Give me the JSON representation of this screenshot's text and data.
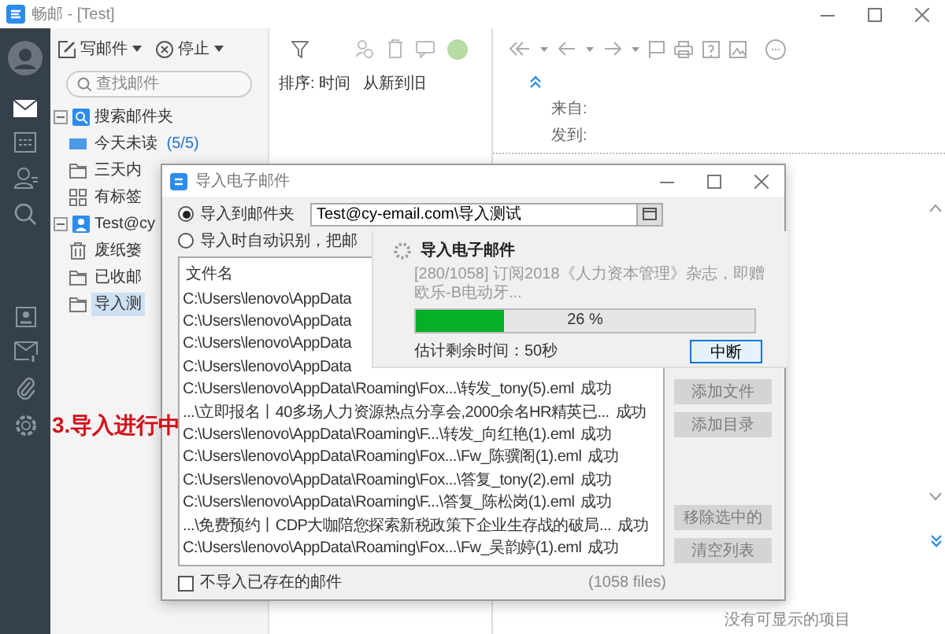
{
  "window": {
    "title": "畅邮 - [Test]"
  },
  "nav": [
    {
      "kind": "mail",
      "selected": true
    },
    {
      "kind": "calendar",
      "selected": false
    },
    {
      "kind": "contacts",
      "selected": false
    },
    {
      "kind": "search",
      "selected": false
    },
    {
      "kind": "card",
      "selected": false
    },
    {
      "kind": "compose",
      "selected": false
    },
    {
      "kind": "attachment",
      "selected": false
    },
    {
      "kind": "settings",
      "selected": false
    }
  ],
  "toolbar": {
    "compose": "写邮件",
    "stop": "停止"
  },
  "search": {
    "placeholder": "查找邮件"
  },
  "folders": [
    {
      "label": "搜索邮件夹",
      "kind": "search",
      "expanded": true,
      "children": [
        {
          "label": "今天未读",
          "count": "(5/5)",
          "kind": "unread",
          "selected": false
        },
        {
          "label": "三天内",
          "kind": "folder",
          "selected": false
        },
        {
          "label": "有标签",
          "kind": "tag",
          "selected": false
        }
      ]
    },
    {
      "label": "Test@cy",
      "kind": "account",
      "expanded": true,
      "children": [
        {
          "label": "废纸篓",
          "kind": "trash",
          "selected": false
        },
        {
          "label": "已收邮",
          "kind": "folder",
          "selected": false
        },
        {
          "label": "导入测",
          "kind": "folder",
          "selected": true
        }
      ]
    }
  ],
  "mail_list": {
    "sort_label": "排序: 时间",
    "sort_order": "从新到旧"
  },
  "reading_pane": {
    "from_label": "来自:",
    "to_label": "发到:",
    "empty": "没有可显示的项目"
  },
  "dialog": {
    "title": "导入电子邮件",
    "options": [
      {
        "label": "导入到邮件夹",
        "selected": true
      },
      {
        "label": "导入时自动识别，把邮",
        "selected": false
      }
    ],
    "folder_value": "Test@cy-email.com\\导入测试",
    "list": {
      "header": "文件名",
      "rows": [
        {
          "column_1": "C:\\Users\\lenovo\\AppData"
        },
        {
          "column_1": "C:\\Users\\lenovo\\AppData"
        },
        {
          "column_1": "C:\\Users\\lenovo\\AppData"
        },
        {
          "column_1": "C:\\Users\\lenovo\\AppData"
        },
        {
          "column_1": "C:\\Users\\lenovo\\AppData\\Roaming\\Fox...\\转发_tony(5).eml",
          "column_2": "成功"
        },
        {
          "column_1": "...\\立即报名丨40多场人力资源热点分享会,2000余名HR精英已...",
          "column_2": "成功"
        },
        {
          "column_1": "C:\\Users\\lenovo\\AppData\\Roaming\\F...\\转发_向红艳(1).eml",
          "column_2": "成功"
        },
        {
          "column_1": "C:\\Users\\lenovo\\AppData\\Roaming\\Fox...\\Fw_陈骥阁(1).eml",
          "column_2": "成功"
        },
        {
          "column_1": "C:\\Users\\lenovo\\AppData\\Roaming\\Fox...\\答复_tony(2).eml",
          "column_2": "成功"
        },
        {
          "column_1": "C:\\Users\\lenovo\\AppData\\Roaming\\F...\\答复_陈松岗(1).eml",
          "column_2": "成功"
        },
        {
          "column_1": "...\\免费预约丨CDP大咖陪您探索新税政策下企业生存战的破局...",
          "column_2": "成功"
        },
        {
          "column_1": "C:\\Users\\lenovo\\AppData\\Roaming\\Fox...\\Fw_吴韵婷(1).eml",
          "column_2": "成功"
        }
      ]
    },
    "skip_existing": {
      "label": "不导入已存在的邮件",
      "checked": false
    },
    "file_count": "(1058 files)",
    "buttons": [
      {
        "label": "添加文件",
        "disabled": true
      },
      {
        "label": "添加目录",
        "disabled": true
      },
      {
        "label": "移除选中的",
        "disabled": true
      },
      {
        "label": "清空列表",
        "disabled": true
      }
    ],
    "progress": {
      "title": "导入电子邮件",
      "detail": "[280/1058] 订阅2018《人力资本管理》杂志，即赠欧乐-B电动牙...",
      "level": 0.26,
      "reading": "26 %",
      "remaining": "估计剩余时间：50秒",
      "cancel": "中断"
    }
  },
  "annotation": "3.导入进行中"
}
